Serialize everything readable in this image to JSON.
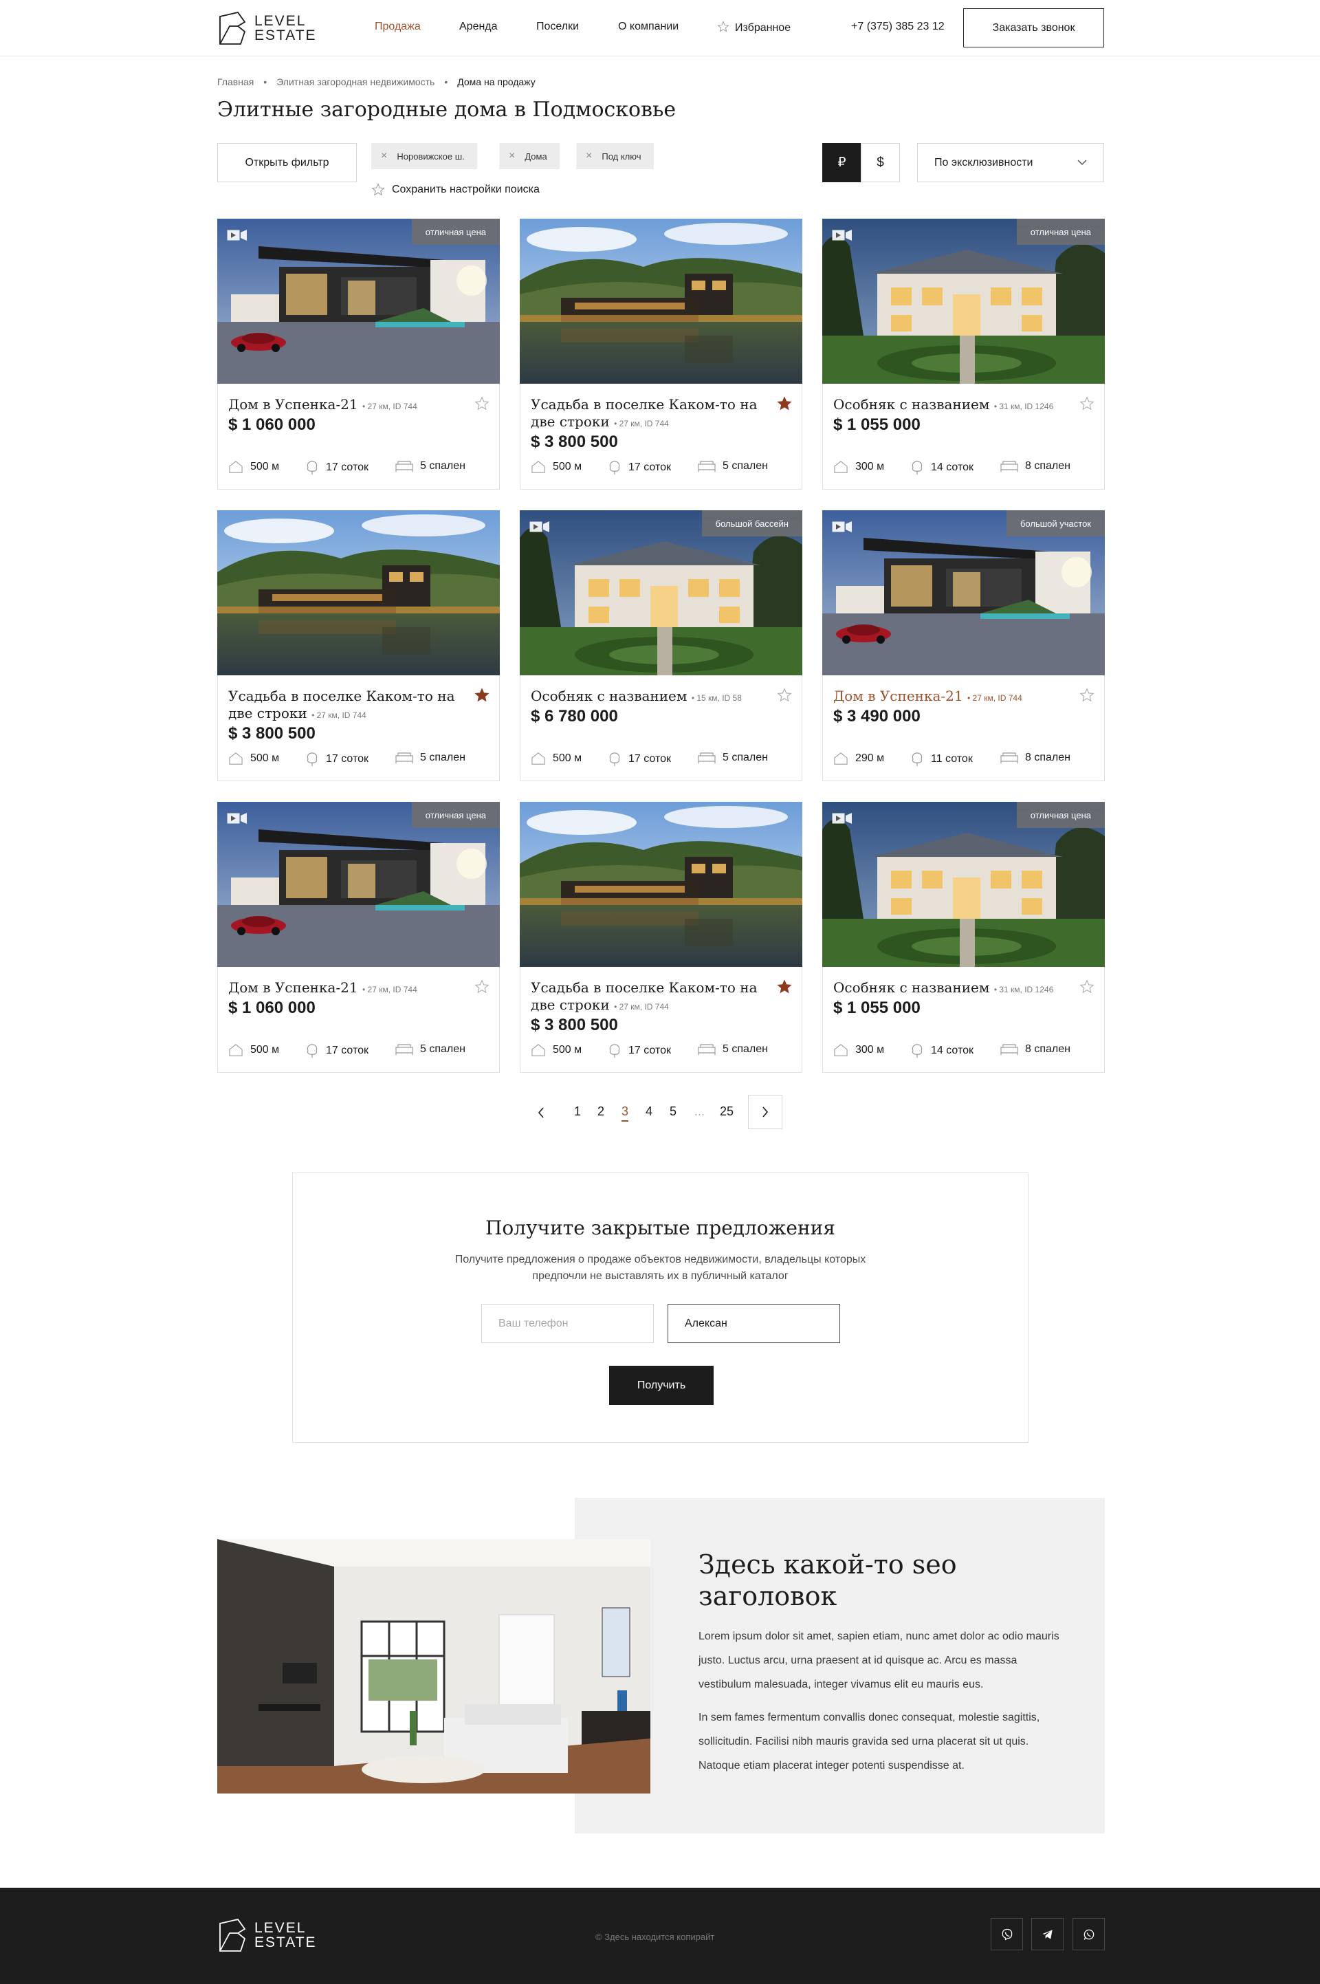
{
  "header": {
    "logo_line1": "LEVEL",
    "logo_line2": "ESTATE",
    "nav": [
      {
        "label": "Продажа",
        "active": true
      },
      {
        "label": "Аренда"
      },
      {
        "label": "Поселки"
      },
      {
        "label": "О компании"
      },
      {
        "label": "Избранное",
        "icon": "star-icon"
      }
    ],
    "phone": "+7 (375) 385 23 12",
    "call_button": "Заказать звонок"
  },
  "breadcrumbs": [
    "Главная",
    "Элитная загородная недвижимость",
    "Дома на продажу"
  ],
  "page_title": "Элитные загородные дома в Подмосковье",
  "filters": {
    "open_filter": "Открыть фильтр",
    "chips": [
      "Норовижское ш.",
      "Дома",
      "Под ключ"
    ],
    "save_search": "Сохранить настройки поиска",
    "currencies": [
      "₽",
      "$"
    ],
    "active_currency": "₽",
    "sort": "По эксклюзивности"
  },
  "listings": [
    {
      "title": "Дом в Успенка-21",
      "meta": "27 км, ID 744",
      "price": "$ 1 060 000",
      "area": "500 м",
      "land": "17 соток",
      "beds": "5 спален",
      "badge": "отличная цена",
      "video": true,
      "favorite": false,
      "image": "modern-villa"
    },
    {
      "title": "Усадьба в поселке Каком-то на две строки",
      "meta": "27 км, ID 744",
      "price": "$ 3 800 500",
      "area": "500 м",
      "land": "17 соток",
      "beds": "5 спален",
      "badge": "",
      "video": false,
      "favorite": true,
      "image": "lake-house"
    },
    {
      "title": "Особняк с названием",
      "meta": "31 км, ID 1246",
      "price": "$ 1 055 000",
      "area": "300 м",
      "land": "14 соток",
      "beds": "8 спален",
      "badge": "отличная цена",
      "video": true,
      "favorite": false,
      "image": "mansion"
    },
    {
      "title": "Усадьба в поселке Каком-то на две строки",
      "meta": "27 км, ID 744",
      "price": "$ 3 800 500",
      "area": "500 м",
      "land": "17 соток",
      "beds": "5 спален",
      "badge": "",
      "video": false,
      "favorite": true,
      "image": "lake-house"
    },
    {
      "title": "Особняк с названием",
      "meta": "15 км, ID 58",
      "price": "$ 6 780 000",
      "area": "500 м",
      "land": "17 соток",
      "beds": "5 спален",
      "badge": "большой бассейн",
      "video": true,
      "favorite": false,
      "image": "mansion"
    },
    {
      "title": "Дом в Успенка-21",
      "meta": "27 км, ID 744",
      "price": "$ 3 490 000",
      "area": "290 м",
      "land": "11 соток",
      "beds": "8 спален",
      "badge": "большой участок",
      "video": true,
      "favorite": false,
      "image": "modern-villa",
      "hover": true
    },
    {
      "title": "Дом в Успенка-21",
      "meta": "27 км, ID 744",
      "price": "$ 1 060 000",
      "area": "500 м",
      "land": "17 соток",
      "beds": "5 спален",
      "badge": "отличная цена",
      "video": true,
      "favorite": false,
      "image": "modern-villa"
    },
    {
      "title": "Усадьба в поселке Каком-то на две строки",
      "meta": "27 км, ID 744",
      "price": "$ 3 800 500",
      "area": "500 м",
      "land": "17 соток",
      "beds": "5 спален",
      "badge": "",
      "video": false,
      "favorite": true,
      "image": "lake-house"
    },
    {
      "title": "Особняк с названием",
      "meta": "31 км, ID 1246",
      "price": "$ 1 055 000",
      "area": "300 м",
      "land": "14 соток",
      "beds": "8 спален",
      "badge": "отличная цена",
      "video": true,
      "favorite": false,
      "image": "mansion"
    }
  ],
  "pagination": {
    "pages": [
      "1",
      "2",
      "3",
      "4",
      "5",
      "...",
      "25"
    ],
    "current": "3"
  },
  "subscribe": {
    "title": "Получите закрытые предложения",
    "text_line1": "Получите предложения о продаже объектов недвижимости, владельцы которых",
    "text_line2": "предпочли не выставлять их в публичный каталог",
    "phone_placeholder": "Ваш телефон",
    "name_value": "Алексан",
    "button": "Получить"
  },
  "seo": {
    "title": "Здесь какой-то seo заголовок",
    "p1": "Lorem ipsum dolor sit amet, sapien etiam, nunc amet dolor ac odio mauris justo. Luctus arcu, urna praesent at id quisque ac. Arcu es massa vestibulum malesuada, integer vivamus elit eu mauris eus.",
    "p2": "In sem fames fermentum convallis donec consequat, molestie sagittis, sollicitudin. Facilisi nibh mauris gravida sed urna placerat sit ut quis. Natoque etiam placerat integer potenti suspendisse at."
  },
  "footer": {
    "logo_line1": "LEVEL",
    "logo_line2": "ESTATE",
    "copyright": "© Здесь находится копирайт",
    "socials": [
      "viber-icon",
      "telegram-icon",
      "whatsapp-icon"
    ]
  },
  "colors": {
    "accent": "#a0522d",
    "dark": "#1c1c1c",
    "footer_bg": "#1d1d1d",
    "seo_bg": "#f0f0f0"
  }
}
